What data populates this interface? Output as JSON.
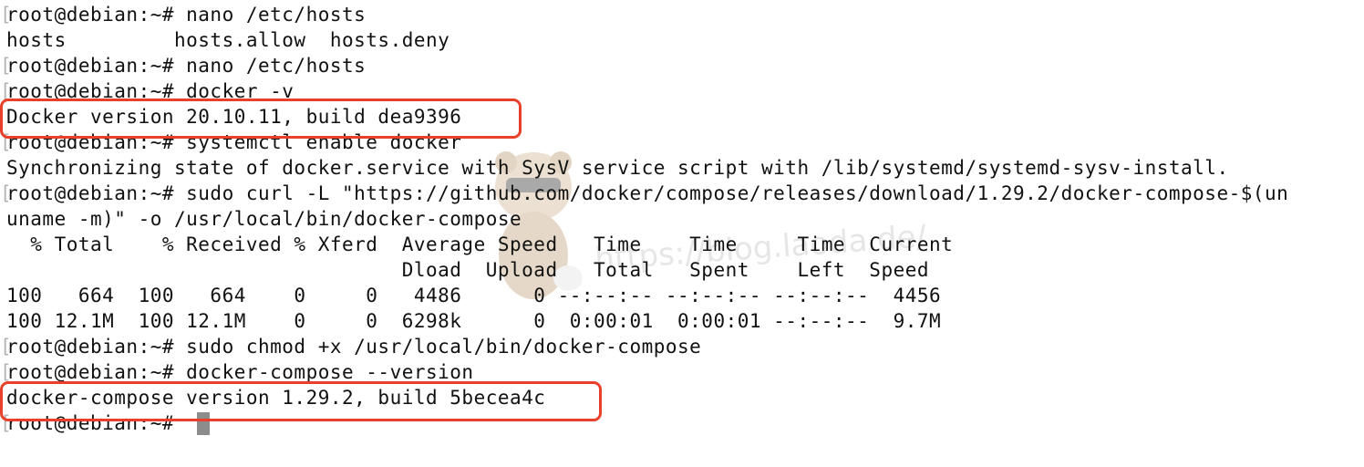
{
  "terminal": {
    "lines": [
      "root@debian:~# nano /etc/hosts",
      "hosts         hosts.allow  hosts.deny",
      "root@debian:~# nano /etc/hosts",
      "root@debian:~# docker -v",
      "Docker version 20.10.11, build dea9396",
      "root@debian:~# systemctl enable docker",
      "Synchronizing state of docker.service with SysV service script with /lib/systemd/systemd-sysv-install.",
      "root@debian:~# sudo curl -L \"https://github.com/docker/compose/releases/download/1.29.2/docker-compose-$(un",
      "uname -m)\" -o /usr/local/bin/docker-compose",
      "  % Total    % Received % Xferd  Average Speed   Time    Time     Time  Current",
      "                                 Dload  Upload   Total   Spent    Left  Speed",
      "100   664  100   664    0     0   4486      0 --:--:-- --:--:-- --:--:--  4456",
      "100 12.1M  100 12.1M    0     0  6298k      0  0:00:01  0:00:01 --:--:--  9.7M",
      "root@debian:~# sudo chmod +x /usr/local/bin/docker-compose",
      "root@debian:~# docker-compose --version",
      "docker-compose version 1.29.2, build 5becea4c",
      "root@debian:~# "
    ]
  },
  "watermark": "https://blog.laoda.de/",
  "colors": {
    "text": "#111111",
    "highlight": "#e8402a",
    "cursor": "#8c8c8c",
    "background": "#ffffff"
  },
  "icons": {
    "mascot": "cartoon-bear-mascot-icon"
  }
}
